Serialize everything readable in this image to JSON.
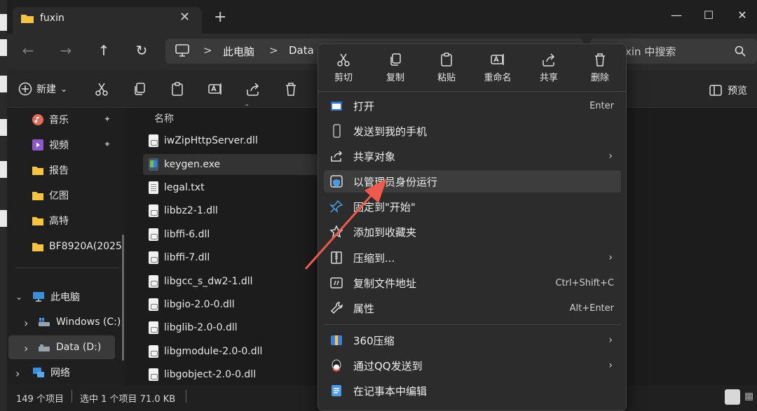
{
  "window": {
    "tab_title": "fuxin",
    "new_tab_symbol": "+",
    "minimize_symbol": "—",
    "maximize_symbol": "☐",
    "close_symbol": "✕",
    "tab_close_symbol": "✕"
  },
  "address": {
    "crumbs": [
      "此电脑",
      "Data ("
    ],
    "separator": ">",
    "search_placeholder": "xin 中搜索"
  },
  "toolbar": {
    "new_label": "新建",
    "new_chevron": "⌄",
    "preview_label": "预览"
  },
  "sidebar": {
    "items": [
      {
        "label": "音乐",
        "pinned": true
      },
      {
        "label": "视频",
        "pinned": true
      },
      {
        "label": "报告"
      },
      {
        "label": "亿图"
      },
      {
        "label": "高特"
      },
      {
        "label": "BF8920A(2025"
      },
      {
        "label": "此电脑"
      },
      {
        "label": "Windows (C:)"
      },
      {
        "label": "Data (D:)"
      },
      {
        "label": "网络"
      }
    ],
    "pin_symbol": "📌",
    "expand_symbol": "›",
    "collapse_symbol": "⌄"
  },
  "filelist": {
    "column_header": "名称",
    "files": [
      {
        "name": "iwZipHttpServer.dll",
        "type": "dll"
      },
      {
        "name": "keygen.exe",
        "type": "exe",
        "selected": true
      },
      {
        "name": "legal.txt",
        "type": "txt"
      },
      {
        "name": "libbz2-1.dll",
        "type": "dll"
      },
      {
        "name": "libffi-6.dll",
        "type": "dll"
      },
      {
        "name": "libffi-7.dll",
        "type": "dll"
      },
      {
        "name": "libgcc_s_dw2-1.dll",
        "type": "dll"
      },
      {
        "name": "libgio-2.0-0.dll",
        "type": "dll"
      },
      {
        "name": "libglib-2.0-0.dll",
        "type": "dll"
      },
      {
        "name": "libgmodule-2.0-0.dll",
        "type": "dll"
      },
      {
        "name": "libgobject-2.0-0.dll",
        "type": "dll"
      }
    ]
  },
  "status": {
    "count": "149 个项目",
    "selection": "选中 1 个项目  71.0 KB",
    "sep": "|"
  },
  "context_menu": {
    "quick_actions": [
      "剪切",
      "复制",
      "粘贴",
      "重命名",
      "共享",
      "删除"
    ],
    "items": [
      {
        "label": "打开",
        "shortcut": "Enter"
      },
      {
        "label": "发送到我的手机"
      },
      {
        "label": "共享对象",
        "submenu": true
      },
      {
        "label": "以管理员身份运行",
        "highlight": true
      },
      {
        "label": "固定到\"开始\""
      },
      {
        "label": "添加到收藏夹"
      },
      {
        "label": "压缩到...",
        "submenu": true
      },
      {
        "label": "复制文件地址",
        "shortcut": "Ctrl+Shift+C"
      },
      {
        "label": "属性",
        "shortcut": "Alt+Enter"
      },
      {
        "label": "360压缩",
        "submenu": true
      },
      {
        "label": "通过QQ发送到",
        "submenu": true
      },
      {
        "label": "在记事本中编辑"
      }
    ],
    "submenu_symbol": "›"
  },
  "colors": {
    "annotation_arrow": "#f05a4e",
    "accent": "#4cc2ff",
    "folder": "#f7c343"
  }
}
